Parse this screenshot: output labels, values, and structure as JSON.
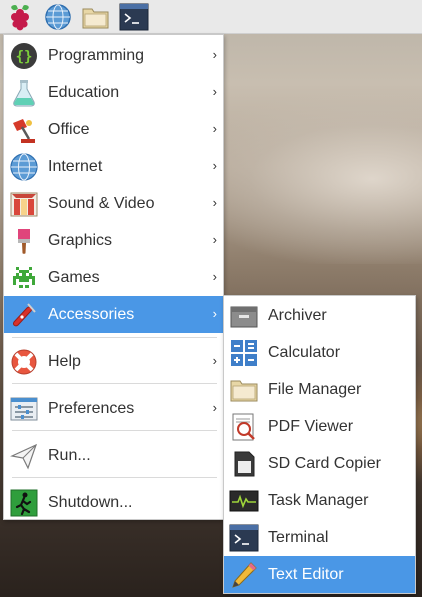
{
  "taskbar": {
    "buttons": [
      {
        "icon": "raspberry-pi-logo-icon"
      },
      {
        "icon": "web-browser-icon"
      },
      {
        "icon": "file-manager-icon"
      },
      {
        "icon": "terminal-icon"
      }
    ]
  },
  "main_menu": {
    "items": [
      {
        "label": "Programming",
        "icon": "programming-icon",
        "has_submenu": true
      },
      {
        "label": "Education",
        "icon": "education-icon",
        "has_submenu": true
      },
      {
        "label": "Office",
        "icon": "office-icon",
        "has_submenu": true
      },
      {
        "label": "Internet",
        "icon": "internet-icon",
        "has_submenu": true
      },
      {
        "label": "Sound & Video",
        "icon": "sound-video-icon",
        "has_submenu": true
      },
      {
        "label": "Graphics",
        "icon": "graphics-icon",
        "has_submenu": true
      },
      {
        "label": "Games",
        "icon": "games-icon",
        "has_submenu": true
      },
      {
        "label": "Accessories",
        "icon": "accessories-icon",
        "has_submenu": true,
        "selected": true
      },
      {
        "label": "Help",
        "icon": "help-icon",
        "has_submenu": true
      },
      {
        "label": "Preferences",
        "icon": "preferences-icon",
        "has_submenu": true
      },
      {
        "label": "Run...",
        "icon": "run-icon",
        "has_submenu": false
      },
      {
        "label": "Shutdown...",
        "icon": "shutdown-icon",
        "has_submenu": false
      }
    ],
    "chevron": "›"
  },
  "accessories_submenu": {
    "items": [
      {
        "label": "Archiver",
        "icon": "archiver-icon"
      },
      {
        "label": "Calculator",
        "icon": "calculator-icon"
      },
      {
        "label": "File Manager",
        "icon": "file-manager-icon"
      },
      {
        "label": "PDF Viewer",
        "icon": "pdf-viewer-icon"
      },
      {
        "label": "SD Card Copier",
        "icon": "sd-card-copier-icon"
      },
      {
        "label": "Task Manager",
        "icon": "task-manager-icon"
      },
      {
        "label": "Terminal",
        "icon": "terminal-icon"
      },
      {
        "label": "Text Editor",
        "icon": "text-editor-icon",
        "selected": true
      }
    ]
  },
  "colors": {
    "selection": "#4a97e6",
    "menu_background": "#ffffff",
    "taskbar_background": "#e9e9e9"
  }
}
